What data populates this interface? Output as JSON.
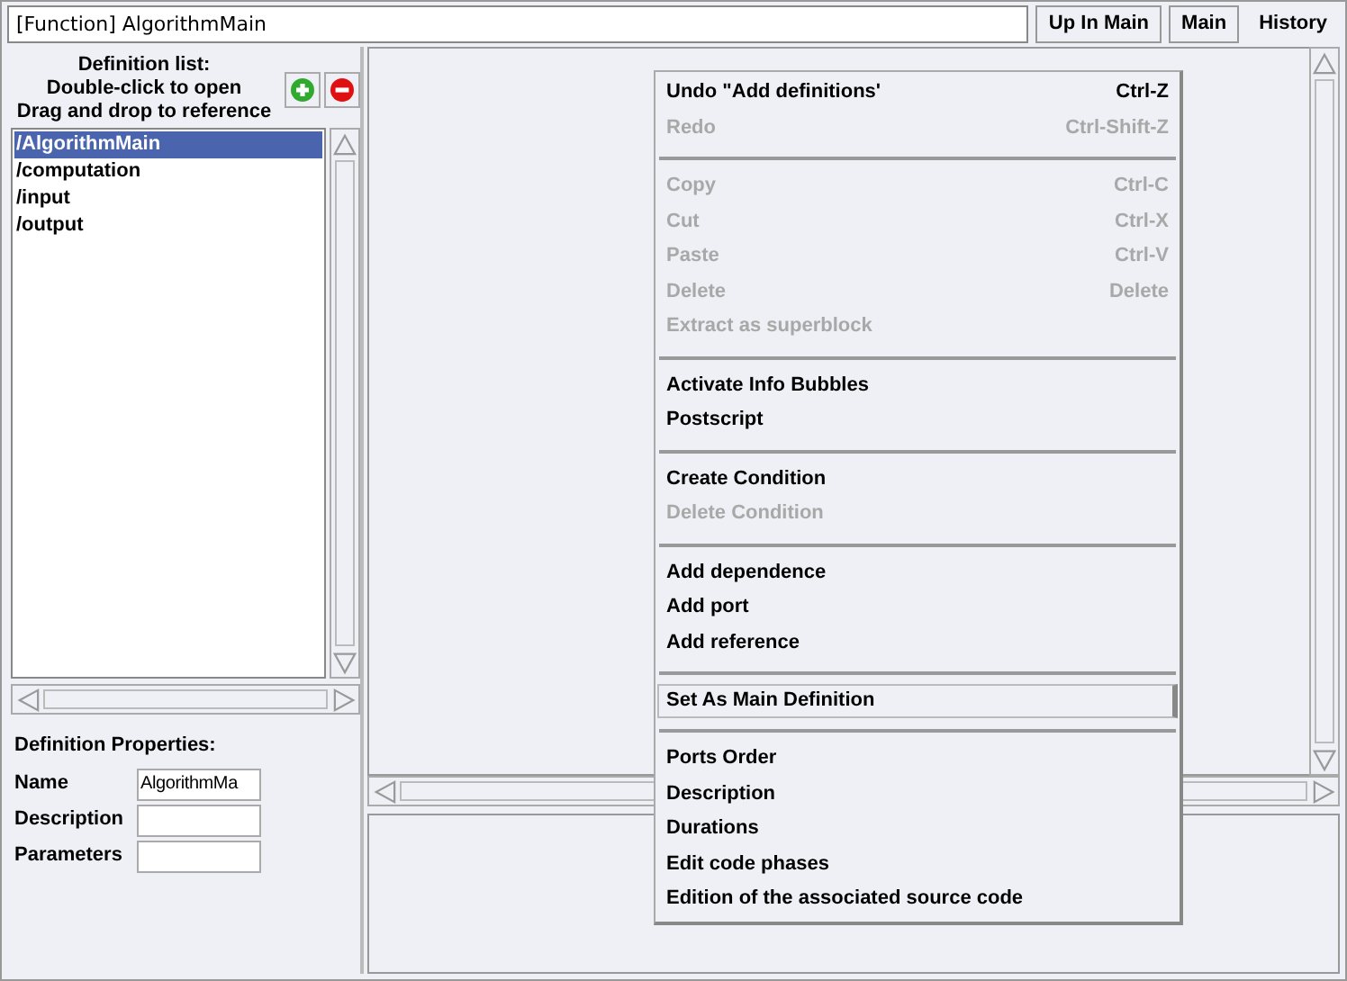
{
  "path_field": {
    "value": "[Function] AlgorithmMain"
  },
  "toolbar_buttons": [
    "Up In Main",
    "Main",
    "History"
  ],
  "definition_list": {
    "heading": [
      "Definition list:",
      "Double-click to open",
      "Drag and drop to reference"
    ],
    "items": [
      {
        "label": "/AlgorithmMain",
        "selected": true
      },
      {
        "label": "/computation",
        "selected": false
      },
      {
        "label": "/input",
        "selected": false
      },
      {
        "label": "/output",
        "selected": false
      }
    ]
  },
  "properties": {
    "title": "Definition Properties:",
    "fields": [
      {
        "label": "Name",
        "value": "AlgorithmMa"
      },
      {
        "label": "Description"
      },
      {
        "label": "Parameters"
      }
    ]
  },
  "context_menu": {
    "groups": [
      [
        {
          "label": "Undo \"Add definitions'",
          "shortcut": "Ctrl-Z",
          "disabled": false,
          "highlighted": false
        },
        {
          "label": "Redo",
          "shortcut": "Ctrl-Shift-Z",
          "disabled": true,
          "highlighted": false
        }
      ],
      [
        {
          "label": "Copy",
          "shortcut": "Ctrl-C",
          "disabled": true,
          "highlighted": false
        },
        {
          "label": "Cut",
          "shortcut": "Ctrl-X",
          "disabled": true,
          "highlighted": false
        },
        {
          "label": "Paste",
          "shortcut": "Ctrl-V",
          "disabled": true,
          "highlighted": false
        },
        {
          "label": "Delete",
          "shortcut": "Delete",
          "disabled": true,
          "highlighted": false
        },
        {
          "label": "Extract as superblock",
          "disabled": true,
          "highlighted": false
        }
      ],
      [
        {
          "label": "Activate Info Bubbles",
          "disabled": false,
          "highlighted": false
        },
        {
          "label": "Postscript",
          "disabled": false,
          "highlighted": false
        }
      ],
      [
        {
          "label": "Create Condition",
          "disabled": false,
          "highlighted": false
        },
        {
          "label": "Delete Condition",
          "disabled": true,
          "highlighted": false
        }
      ],
      [
        {
          "label": "Add dependence",
          "disabled": false,
          "highlighted": false
        },
        {
          "label": "Add port",
          "disabled": false,
          "highlighted": false
        },
        {
          "label": "Add reference",
          "disabled": false,
          "highlighted": false
        }
      ],
      [
        {
          "label": "Set As Main Definition",
          "disabled": false,
          "highlighted": true
        }
      ],
      [
        {
          "label": "Ports Order",
          "disabled": false,
          "highlighted": false
        },
        {
          "label": "Description",
          "disabled": false,
          "highlighted": false
        },
        {
          "label": "Durations",
          "disabled": false,
          "highlighted": false
        },
        {
          "label": "Edit code phases",
          "disabled": false,
          "highlighted": false
        },
        {
          "label": "Edition of the associated source code",
          "disabled": false,
          "highlighted": false
        }
      ]
    ]
  }
}
